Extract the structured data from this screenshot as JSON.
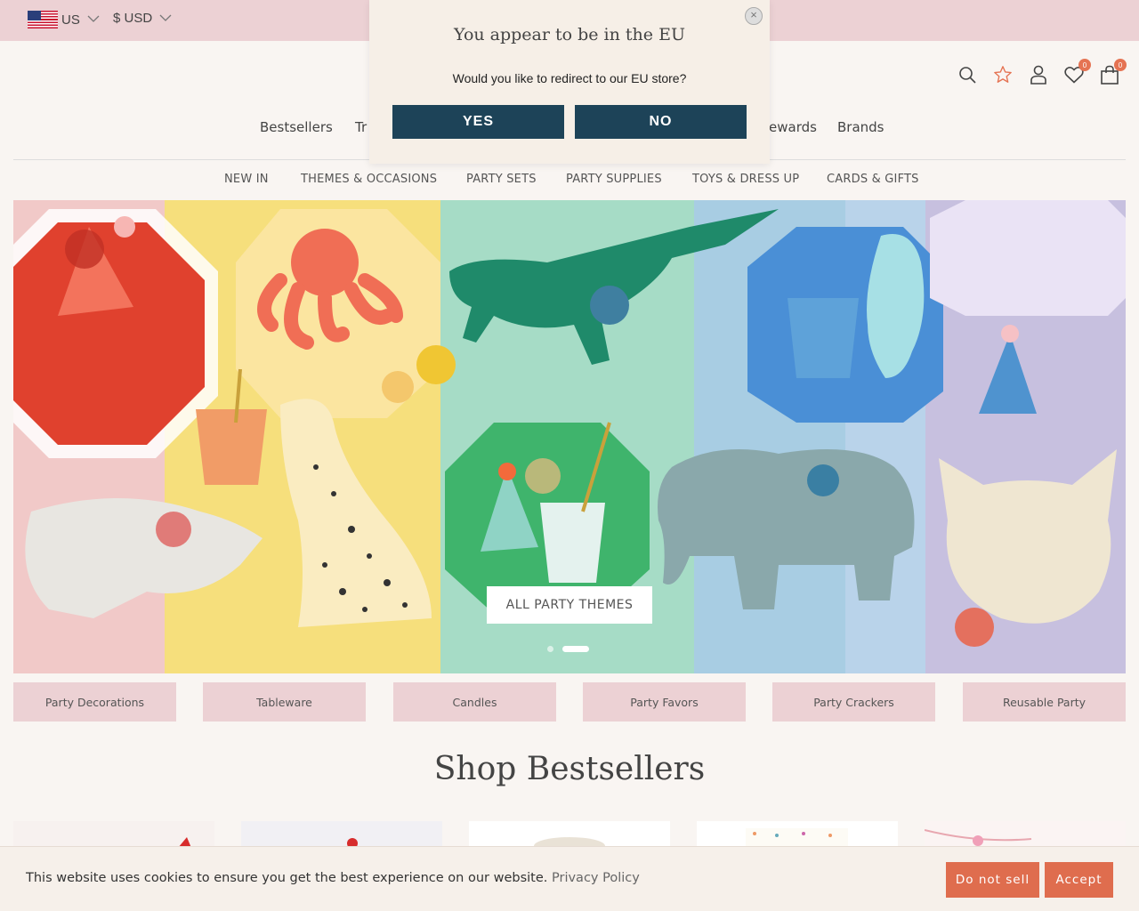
{
  "topbar": {
    "country": "US",
    "currency": "$ USD"
  },
  "header": {
    "icons": [
      "search-icon",
      "star-icon",
      "user-icon",
      "heart-icon",
      "bag-icon"
    ],
    "wishlist_count": "0",
    "cart_count": "0"
  },
  "main_nav": [
    {
      "label": "Bestsellers"
    },
    {
      "label": "Tr"
    },
    {
      "label": "ewards"
    },
    {
      "label": "Brands"
    }
  ],
  "category_nav": [
    {
      "label": "NEW IN"
    },
    {
      "label": "THEMES & OCCASIONS"
    },
    {
      "label": "PARTY SETS"
    },
    {
      "label": "PARTY SUPPLIES"
    },
    {
      "label": "TOYS & DRESS UP"
    },
    {
      "label": "CARDS & GIFTS"
    }
  ],
  "hero": {
    "cta": "ALL PARTY THEMES",
    "slide_count": 2,
    "active_slide": 2
  },
  "tiles": [
    {
      "label": "Party Decorations"
    },
    {
      "label": "Tableware"
    },
    {
      "label": "Candles"
    },
    {
      "label": "Party Favors"
    },
    {
      "label": "Party Crackers"
    },
    {
      "label": "Reusable Party"
    }
  ],
  "shop_section": {
    "title": "Shop Bestsellers"
  },
  "cookie": {
    "text": "This website uses cookies to ensure you get the best experience on our website.",
    "link": "Privacy Policy",
    "do_not_sell": "Do not sell",
    "accept": "Accept"
  },
  "modal": {
    "title": "You appear to be in the EU",
    "text": "Would you like to redirect to our EU store?",
    "yes": "YES",
    "no": "NO"
  },
  "colors": {
    "topbar_pink": "#ecd1d4",
    "modal_button_navy": "#1d4358",
    "cookie_button_coral": "#df6d4e",
    "badge_coral": "#e57353"
  }
}
